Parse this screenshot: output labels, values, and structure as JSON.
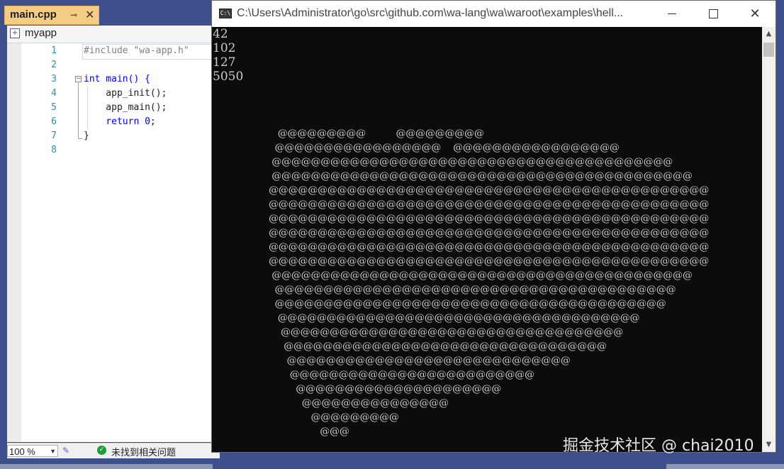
{
  "ide": {
    "tab": {
      "title": "main.cpp",
      "pin_icon": "pin-icon",
      "close_icon": "close-icon"
    },
    "nav": {
      "project": "myapp"
    },
    "editor": {
      "lines": [
        {
          "no": "1",
          "text": "#include \"wa-app.h\""
        },
        {
          "no": "2",
          "text": ""
        },
        {
          "no": "3",
          "text": "int main() {"
        },
        {
          "no": "4",
          "text": "    app_init();"
        },
        {
          "no": "5",
          "text": "    app_main();"
        },
        {
          "no": "6",
          "text": "    return 0;"
        },
        {
          "no": "7",
          "text": "}"
        },
        {
          "no": "8",
          "text": ""
        }
      ]
    },
    "status": {
      "zoom": "100 %",
      "issues": "未找到相关问题"
    }
  },
  "console": {
    "title": "C:\\Users\\Administrator\\go\\src\\github.com\\wa-lang\\wa\\waroot\\examples\\hell...",
    "output": [
      "42",
      "102",
      "127",
      "5050"
    ],
    "heart": [
      "   @@@@@@@@@          @@@@@@@@@",
      "  @@@@@@@@@@@@@@@@@    @@@@@@@@@@@@@@@@@",
      " @@@@@@@@@@@@@@@@@@@@@@@@@@@@@@@@@@@@@@@@@",
      " @@@@@@@@@@@@@@@@@@@@@@@@@@@@@@@@@@@@@@@@@@@",
      "@@@@@@@@@@@@@@@@@@@@@@@@@@@@@@@@@@@@@@@@@@@@@",
      "@@@@@@@@@@@@@@@@@@@@@@@@@@@@@@@@@@@@@@@@@@@@@",
      "@@@@@@@@@@@@@@@@@@@@@@@@@@@@@@@@@@@@@@@@@@@@@",
      "@@@@@@@@@@@@@@@@@@@@@@@@@@@@@@@@@@@@@@@@@@@@@",
      "@@@@@@@@@@@@@@@@@@@@@@@@@@@@@@@@@@@@@@@@@@@@@",
      "@@@@@@@@@@@@@@@@@@@@@@@@@@@@@@@@@@@@@@@@@@@@@",
      " @@@@@@@@@@@@@@@@@@@@@@@@@@@@@@@@@@@@@@@@@@@",
      "  @@@@@@@@@@@@@@@@@@@@@@@@@@@@@@@@@@@@@@@@@",
      "  @@@@@@@@@@@@@@@@@@@@@@@@@@@@@@@@@@@@@@@@",
      "   @@@@@@@@@@@@@@@@@@@@@@@@@@@@@@@@@@@@@",
      "    @@@@@@@@@@@@@@@@@@@@@@@@@@@@@@@@@@@",
      "     @@@@@@@@@@@@@@@@@@@@@@@@@@@@@@@@@",
      "      @@@@@@@@@@@@@@@@@@@@@@@@@@@@@",
      "       @@@@@@@@@@@@@@@@@@@@@@@@@",
      "         @@@@@@@@@@@@@@@@@@@@@",
      "           @@@@@@@@@@@@@@@",
      "              @@@@@@@@@",
      "                 @@@"
    ],
    "scroll_up_icon": "scroll-up-icon",
    "scroll_down_icon": "scroll-down-icon"
  },
  "watermark": "掘金技术社区 @ chai2010"
}
